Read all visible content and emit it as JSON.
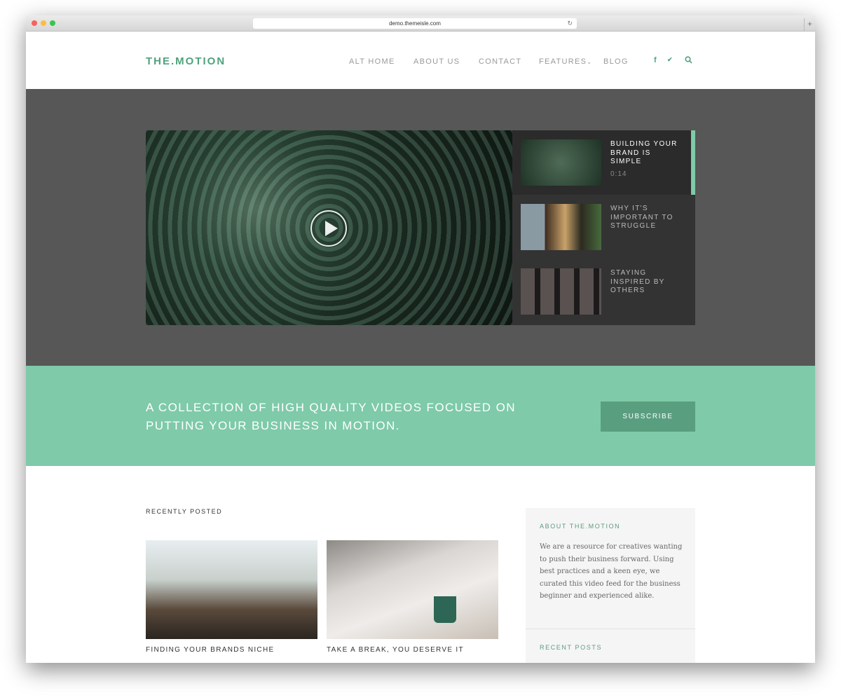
{
  "browser": {
    "url": "demo.themeisle.com"
  },
  "header": {
    "logo": "THE.MOTION",
    "nav": [
      "ALT HOME",
      "ABOUT US",
      "CONTACT",
      "FEATURES",
      "BLOG"
    ],
    "features_caret": "⌄",
    "social": {
      "facebook": "f",
      "twitter": "🐦",
      "search": "⚲"
    }
  },
  "playlist": [
    {
      "title": "BUILDING YOUR BRAND IS SIMPLE",
      "time": "0:14",
      "active": true
    },
    {
      "title": "WHY IT'S IMPORTANT TO STRUGGLE"
    },
    {
      "title": "STAYING INSPIRED BY OTHERS"
    }
  ],
  "band": {
    "text": "A COLLECTION OF HIGH QUALITY VIDEOS FOCUSED ON PUTTING YOUR BUSINESS IN MOTION.",
    "button": "SUBSCRIBE"
  },
  "recent": {
    "heading": "RECENTLY POSTED",
    "posts": [
      {
        "title": "FINDING YOUR BRANDS NICHE"
      },
      {
        "title": "TAKE A BREAK, YOU DESERVE IT"
      }
    ]
  },
  "sidebar": {
    "about_heading": "ABOUT THE.MOTION",
    "about_text": "We are a resource for creatives wanting to push their business forward. Using best practices and a keen eye, we curated this video feed for the business beginner and experienced alike.",
    "recent_heading": "RECENT POSTS"
  },
  "colors": {
    "accent": "#4fa27d",
    "band": "#7ecaa9",
    "hero": "#575757"
  }
}
